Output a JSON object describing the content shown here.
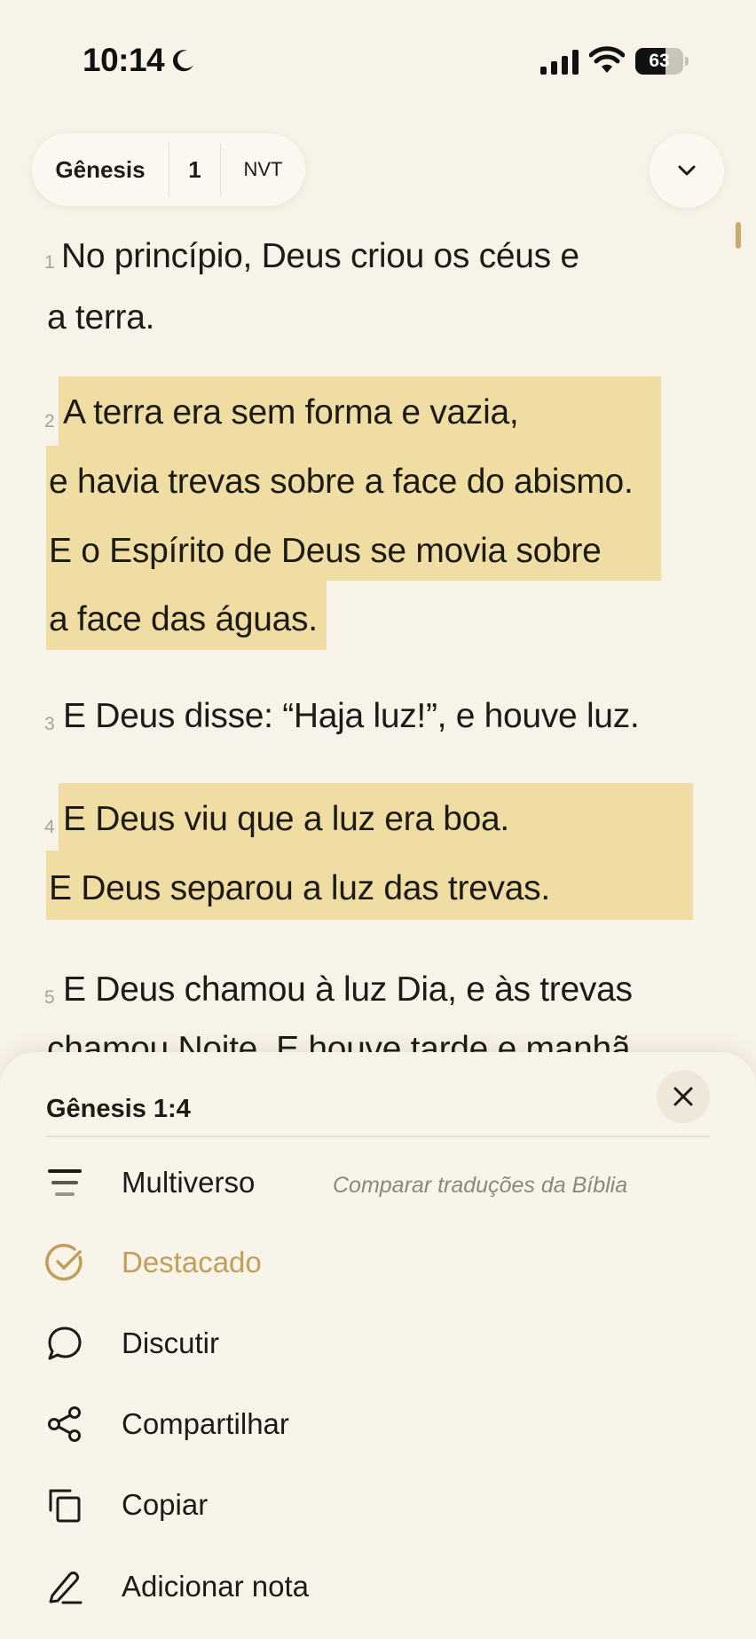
{
  "status_bar": {
    "time": "10:14",
    "battery_level": 63,
    "battery_text": "63",
    "icons": [
      "moon-icon",
      "signal-bars-icon",
      "wifi-icon",
      "battery-icon"
    ]
  },
  "reference": {
    "book": "Gênesis",
    "chapter": "1",
    "version": "NVT"
  },
  "colors": {
    "background": "#f8f3e8",
    "highlight": "#f0dda3",
    "accent_gold": "#bf9f5a",
    "text": "#1d1b16"
  },
  "verses": [
    {
      "number": "1",
      "highlighted": false,
      "lines": [
        "No princípio, Deus criou os céus e",
        "a terra."
      ]
    },
    {
      "number": "2",
      "highlighted": true,
      "lines": [
        "A terra era sem forma e vazia,",
        "e havia trevas sobre a face do abismo.",
        "E o Espírito de Deus se movia sobre",
        "a face das águas."
      ]
    },
    {
      "number": "3",
      "highlighted": false,
      "lines": [
        "E Deus disse: “Haja luz!”, e houve luz."
      ]
    },
    {
      "number": "4",
      "highlighted": true,
      "lines": [
        "E Deus viu que a luz era boa.",
        "E Deus separou a luz das trevas."
      ]
    },
    {
      "number": "5",
      "highlighted": false,
      "lines": [
        "E Deus chamou à luz Dia, e às trevas",
        "chamou Noite. E houve tarde e manhã"
      ]
    }
  ],
  "sheet": {
    "title": "Gênesis 1:4",
    "actions": [
      {
        "label": "Multiverso",
        "hint": "Comparar traduções da Bíblia",
        "icon": "multiverse-lines-icon",
        "active": false
      },
      {
        "label": "Destacado",
        "hint": "",
        "icon": "check-circle-icon",
        "active": true
      },
      {
        "label": "Discutir",
        "hint": "",
        "icon": "chat-bubble-icon",
        "active": false
      },
      {
        "label": "Compartilhar",
        "hint": "",
        "icon": "share-icon",
        "active": false
      },
      {
        "label": "Copiar",
        "hint": "",
        "icon": "copy-icon",
        "active": false
      },
      {
        "label": "Adicionar nota",
        "hint": "",
        "icon": "pencil-icon",
        "active": false
      }
    ]
  }
}
